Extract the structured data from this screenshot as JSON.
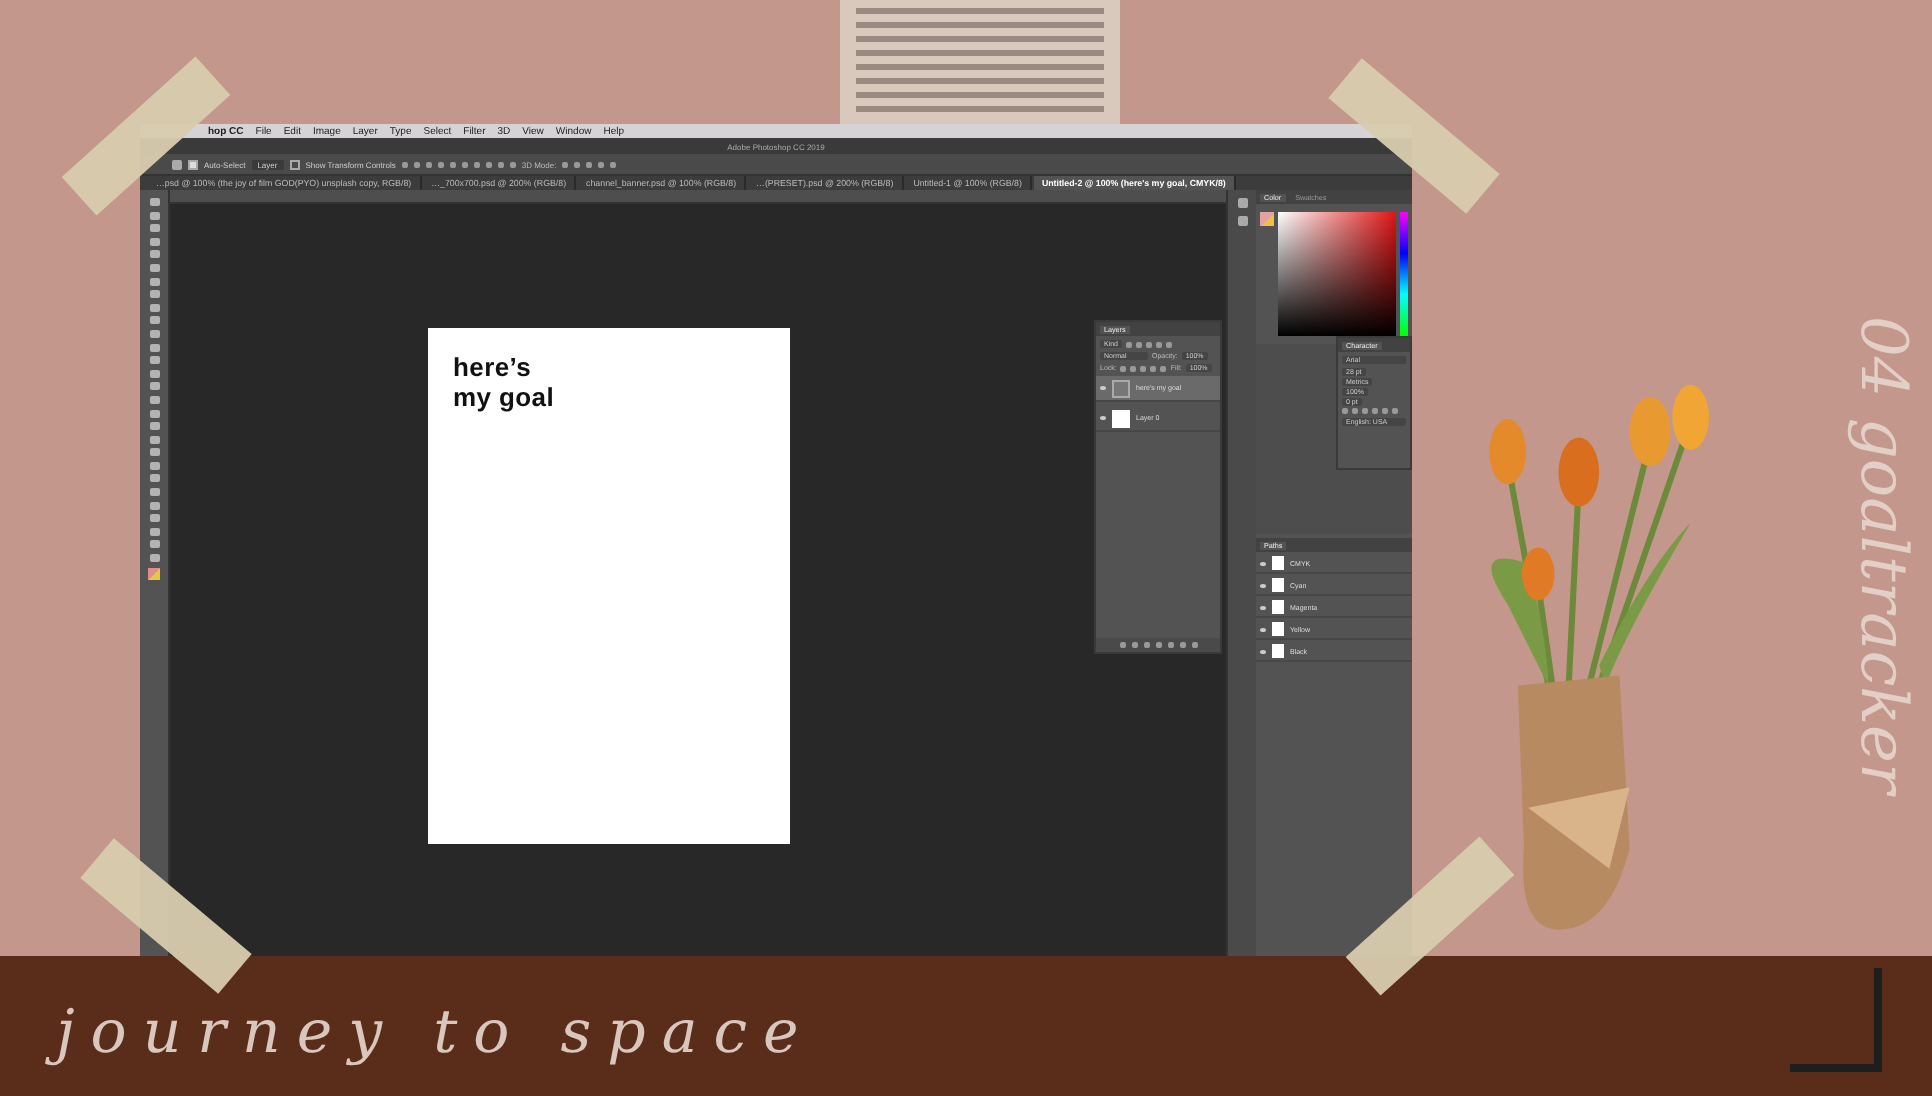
{
  "app": {
    "menu_brand": "hop CC",
    "menus": [
      "File",
      "Edit",
      "Image",
      "Layer",
      "Type",
      "Select",
      "Filter",
      "3D",
      "View",
      "Window",
      "Help"
    ],
    "title": "Adobe Photoshop CC 2019",
    "options": {
      "auto_select": "Auto-Select",
      "auto_select_checked": true,
      "target": "Layer",
      "show_transform": "Show Transform Controls",
      "show_transform_checked": false,
      "mode_3d": "3D Mode:"
    },
    "tabs": [
      {
        "label": "…psd @ 100% (the joy of film GOD(PYO) unsplash copy, RGB/8)",
        "selected": false
      },
      {
        "label": "…_700x700.psd @ 200% (RGB/8)",
        "selected": false
      },
      {
        "label": "channel_banner.psd @ 100% (RGB/8)",
        "selected": false
      },
      {
        "label": "…(PRESET).psd @ 200% (RGB/8)",
        "selected": false
      },
      {
        "label": "Untitled-1 @ 100% (RGB/8)",
        "selected": false
      },
      {
        "label": "Untitled-2 @ 100% (here's my goal, CMYK/8)",
        "selected": true
      }
    ],
    "canvas": {
      "lines": [
        "here’s",
        "my goal"
      ]
    },
    "color_panel": {
      "tabs": [
        {
          "label": "Color",
          "selected": true
        },
        {
          "label": "Swatches",
          "selected": false
        }
      ]
    },
    "layers_panel": {
      "title": "Layers",
      "filter": "Kind",
      "blend": "Normal",
      "opacity_label": "Opacity:",
      "opacity": "100%",
      "lock_label": "Lock:",
      "fill_label": "Fill:",
      "fill": "100%",
      "layers": [
        {
          "name": "here's my goal",
          "kind": "text",
          "visible": true,
          "selected": true
        },
        {
          "name": "Layer 0",
          "kind": "pixel",
          "visible": true,
          "selected": false
        }
      ]
    },
    "character_panel": {
      "title": "Character",
      "font": "Arial",
      "size": "28 pt",
      "kerning": "Metrics",
      "scale": "100%",
      "tracking": "0 pt",
      "language": "English: USA"
    },
    "channels_panel": {
      "tab": "Paths",
      "channels": [
        {
          "name": "CMYK",
          "visible": true
        },
        {
          "name": "Cyan",
          "visible": true
        },
        {
          "name": "Magenta",
          "visible": true
        },
        {
          "name": "Yellow",
          "visible": true
        },
        {
          "name": "Black",
          "visible": true
        }
      ]
    }
  },
  "overlay": {
    "series": "journey to space",
    "episode": "04 goaltracker"
  }
}
